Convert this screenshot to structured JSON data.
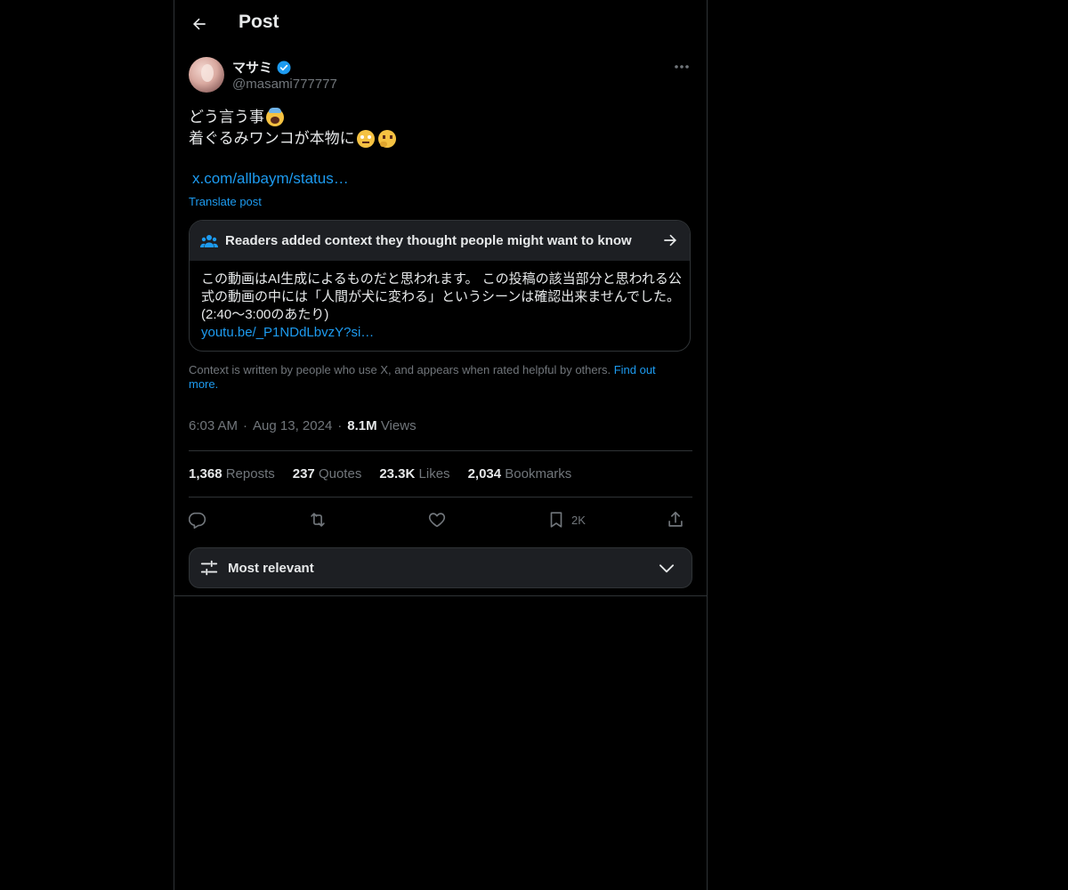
{
  "header": {
    "title": "Post"
  },
  "author": {
    "display_name": "マサミ",
    "handle": "@masami777777"
  },
  "post": {
    "line1": "どう言う事",
    "line2": "着ぐるみワンコが本物に",
    "link": "x.com/allbaym/status…",
    "translate_label": "Translate post"
  },
  "community_note": {
    "title": "Readers added context they thought people might want to know",
    "body": "この動画はAI生成によるものだと思われます。 この投稿の該当部分と思われる公式の動画の中には「人間が犬に変わる」というシーンは確認出来ませんでした。(2:40〜3:00のあたり)",
    "link": "youtu.be/_P1NDdLbvzY?si…"
  },
  "context_info": {
    "text": "Context is written by people who use X, and appears when rated helpful by others. ",
    "link": "Find out more."
  },
  "meta": {
    "time": "6:03 AM",
    "date": "Aug 13, 2024",
    "separator": "·",
    "views": "8.1M",
    "views_label": "Views"
  },
  "stats": [
    {
      "count": "1,368",
      "label": "Reposts"
    },
    {
      "count": "237",
      "label": "Quotes"
    },
    {
      "count": "23.3K",
      "label": "Likes"
    },
    {
      "count": "2,034",
      "label": "Bookmarks"
    }
  ],
  "actions": {
    "bookmark_count": "2K"
  },
  "sort": {
    "label": "Most relevant"
  },
  "colors": {
    "background": "#000000",
    "accent": "#1d9bf0",
    "text": "#e7e9ea",
    "muted": "#71767b",
    "border": "#2f3336"
  },
  "icons": [
    "back-arrow-icon",
    "verified-icon",
    "more-icon",
    "people-icon",
    "arrow-right-icon",
    "reply-icon",
    "repost-icon",
    "like-icon",
    "bookmark-icon",
    "share-icon",
    "sliders-icon",
    "chevron-down-icon"
  ]
}
